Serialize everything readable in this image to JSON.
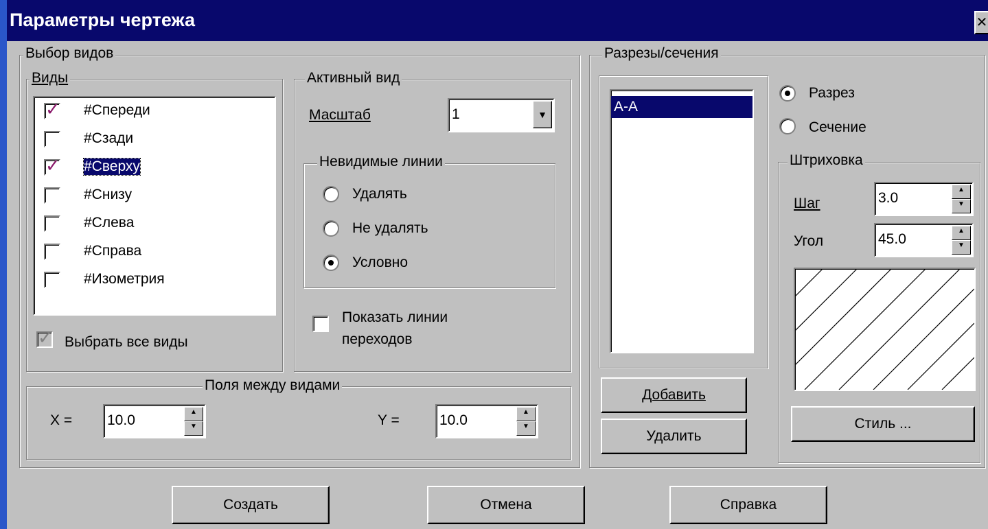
{
  "window": {
    "title": "Параметры чертежа",
    "close": "✕"
  },
  "views_selection": {
    "group_label": "Выбор видов",
    "views_label": "Виды",
    "views": [
      {
        "label": "#Спереди",
        "checked": true
      },
      {
        "label": "#Сзади",
        "checked": false
      },
      {
        "label": "#Сверху",
        "checked": true
      },
      {
        "label": "#Снизу",
        "checked": false
      },
      {
        "label": "#Слева",
        "checked": false
      },
      {
        "label": "#Справа",
        "checked": false
      },
      {
        "label": "#Изометрия",
        "checked": false
      }
    ],
    "select_all_label": "Выбрать все виды",
    "active_view": {
      "group_label": "Активный вид",
      "scale_label": "Масштаб",
      "scale_value": "1",
      "hidden_lines": {
        "group_label": "Невидимые линии",
        "options": [
          "Удалять",
          "Не удалять",
          "Условно"
        ],
        "selected": "Условно"
      },
      "show_transitions_label_1": "Показать линии",
      "show_transitions_label_2": "переходов"
    },
    "margins": {
      "group_label": "Поля между видами",
      "x_label": "X =",
      "x_value": "10.0",
      "y_label": "Y =",
      "y_value": "10.0"
    }
  },
  "sections": {
    "group_label": "Разрезы/сечения",
    "list": [
      "А-А"
    ],
    "add_label": "Добавить",
    "delete_label": "Удалить",
    "type_options": [
      "Разрез",
      "Сечение"
    ],
    "type_selected": "Разрез",
    "hatch": {
      "group_label": "Штриховка",
      "step_label": "Шаг",
      "step_value": "3.0",
      "angle_label": "Угол",
      "angle_value": "45.0",
      "style_label": "Стиль ..."
    }
  },
  "buttons": {
    "create": "Создать",
    "cancel": "Отмена",
    "help": "Справка"
  },
  "colors": {
    "title_bar": "#08086c",
    "dialog_face": "#c0c0c0",
    "selection": "#08086c",
    "check_mark": "#8b1a6b"
  }
}
